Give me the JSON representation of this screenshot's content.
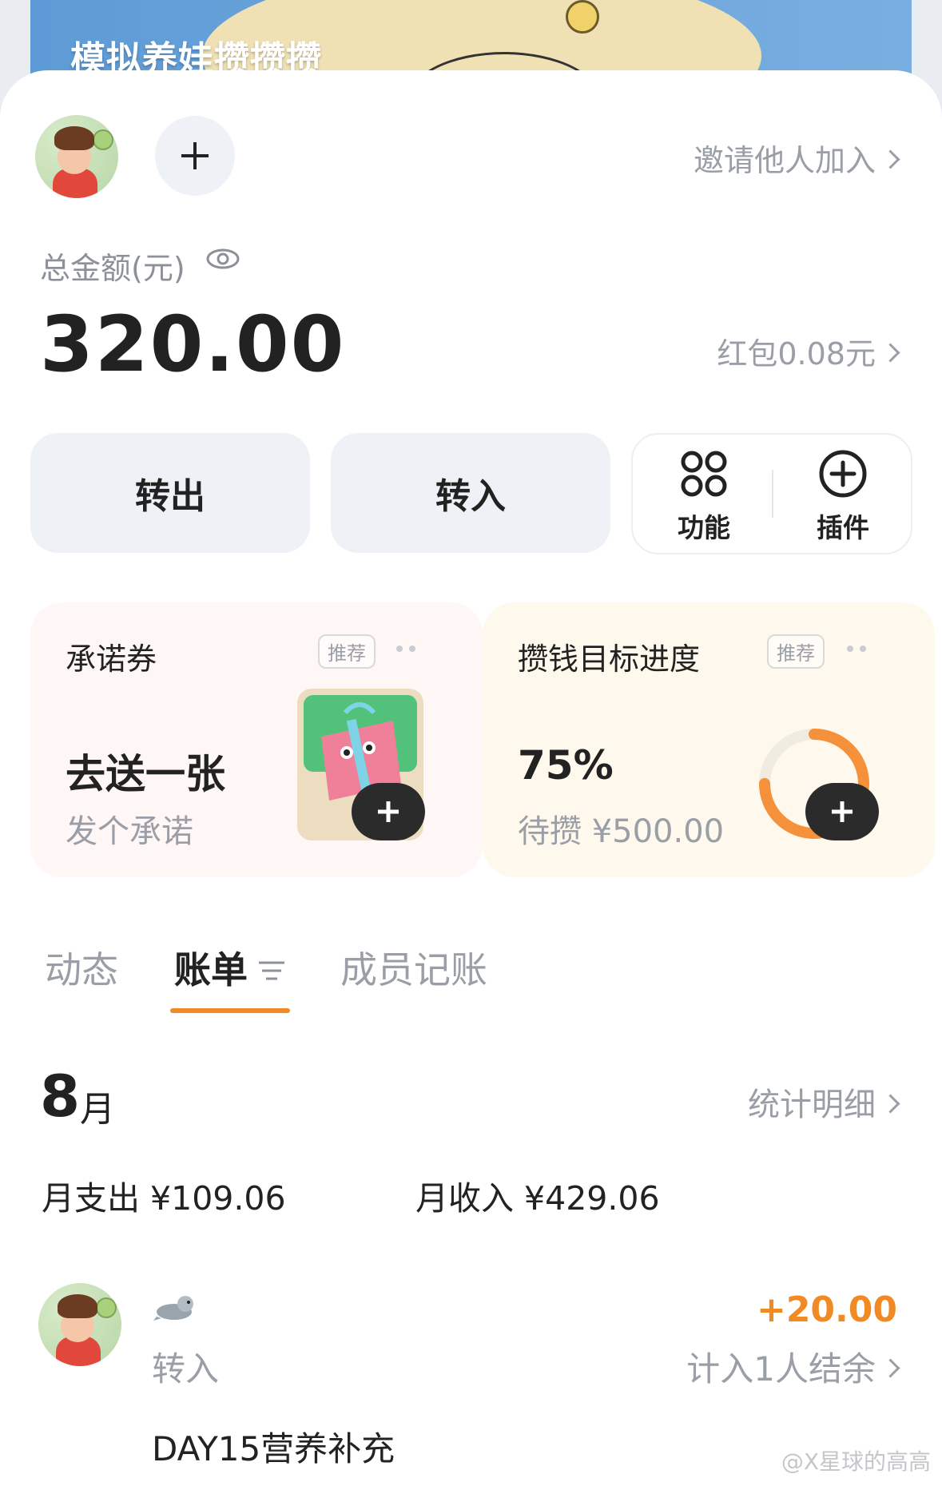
{
  "banner": {
    "title": "模拟养娃攒攒攒"
  },
  "header": {
    "invite_label": "邀请他人加入"
  },
  "balance": {
    "label": "总金额(元)",
    "amount": "320.00",
    "hongbao": "红包0.08元"
  },
  "actions": {
    "transfer_out": "转出",
    "transfer_in": "转入",
    "features": "功能",
    "plugins": "插件"
  },
  "cards": {
    "promise": {
      "title": "承诺券",
      "tag": "推荐",
      "main": "去送一张",
      "sub": "发个承诺"
    },
    "goal": {
      "title": "攒钱目标进度",
      "tag": "推荐",
      "main": "75%",
      "sub": "待攒 ¥500.00",
      "progress": 0.75
    }
  },
  "tabs": [
    {
      "label": "动态"
    },
    {
      "label": "账单"
    },
    {
      "label": "成员记账"
    }
  ],
  "bill": {
    "month_number": "8",
    "month_unit": "月",
    "stat_link": "统计明细",
    "month_out": "月支出 ¥109.06",
    "month_in": "月收入 ¥429.06",
    "entry": {
      "type": "转入",
      "amount": "+20.00",
      "note": "计入1人结余",
      "desc": "DAY15营养补充"
    }
  },
  "watermark": "@X星球的高高",
  "colors": {
    "accent": "#f08a24",
    "promise_bg": "#fff6f6",
    "goal_bg": "#fff8ec"
  },
  "icons": [
    "eye-icon",
    "plus-icon",
    "grid-icon",
    "plus-circle-icon",
    "gift-icon",
    "filter-icon",
    "seal-icon",
    "chevron-right-icon"
  ]
}
